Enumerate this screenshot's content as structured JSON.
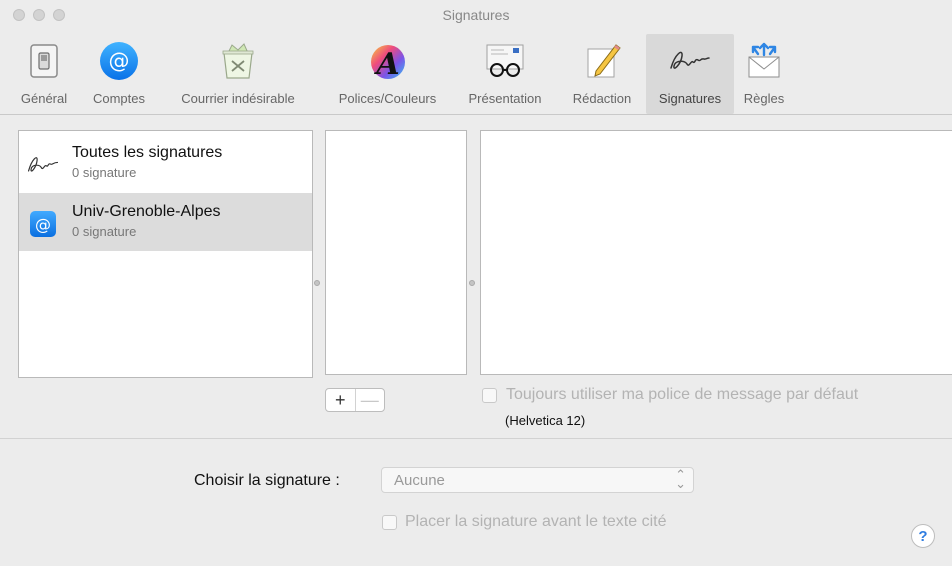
{
  "window": {
    "title": "Signatures"
  },
  "toolbar": {
    "items": [
      {
        "label": "Général",
        "icon": "general-switch-icon"
      },
      {
        "label": "Comptes",
        "icon": "at-sign-icon"
      },
      {
        "label": "Courrier indésirable",
        "icon": "junk-trash-icon"
      },
      {
        "label": "Polices/Couleurs",
        "icon": "fonts-colors-icon"
      },
      {
        "label": "Présentation",
        "icon": "glasses-viewing-icon"
      },
      {
        "label": "Rédaction",
        "icon": "pencil-notepad-icon"
      },
      {
        "label": "Signatures",
        "icon": "signature-icon",
        "selected": true
      },
      {
        "label": "Règles",
        "icon": "rules-envelope-icon"
      }
    ]
  },
  "accounts": [
    {
      "name": "Toutes les signatures",
      "count": "0 signature",
      "icon": "signature-icon"
    },
    {
      "name": "Univ-Grenoble-Alpes",
      "count": "0 signature",
      "icon": "at-sign-icon",
      "selected": true
    }
  ],
  "buttons": {
    "add": "+",
    "remove": "—"
  },
  "options": {
    "use_default_font": "Toujours utiliser ma police de message par défaut",
    "default_font_note": "(Helvetica 12)",
    "choose_label": "Choisir la signature :",
    "choose_value": "Aucune",
    "place_above": "Placer la signature avant le texte cité"
  },
  "help": {
    "label": "?"
  },
  "colors": {
    "accent": "#1a8cff",
    "selected_bg": "#dcdcdc"
  }
}
